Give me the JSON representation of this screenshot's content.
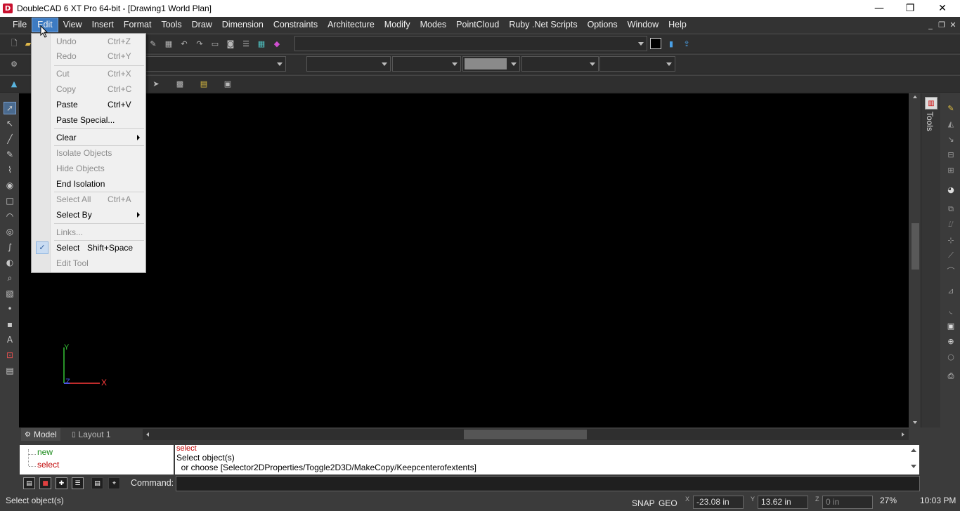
{
  "window": {
    "title": "DoubleCAD 6 XT Pro 64-bit - [Drawing1 World Plan]",
    "controls": {
      "minimize": "—",
      "restore": "❐",
      "close": "✕"
    }
  },
  "menubar": {
    "items": [
      "File",
      "Edit",
      "View",
      "Insert",
      "Format",
      "Tools",
      "Draw",
      "Dimension",
      "Constraints",
      "Architecture",
      "Modify",
      "Modes",
      "PointCloud",
      "Ruby .Net Scripts",
      "Options",
      "Window",
      "Help"
    ],
    "active": "Edit",
    "mdi_controls": {
      "minimize": "_",
      "restore": "❐",
      "close": "✕"
    }
  },
  "edit_menu": {
    "items": [
      {
        "label": "Undo",
        "shortcut": "Ctrl+Z",
        "enabled": false
      },
      {
        "label": "Redo",
        "shortcut": "Ctrl+Y",
        "enabled": false
      },
      {
        "label": "Cut",
        "shortcut": "Ctrl+X",
        "enabled": false
      },
      {
        "label": "Copy",
        "shortcut": "Ctrl+C",
        "enabled": false
      },
      {
        "label": "Paste",
        "shortcut": "Ctrl+V",
        "enabled": true
      },
      {
        "label": "Paste Special...",
        "shortcut": "",
        "enabled": true
      },
      {
        "label": "Clear",
        "shortcut": "",
        "enabled": true,
        "submenu": true
      },
      {
        "label": "Isolate Objects",
        "shortcut": "",
        "enabled": false
      },
      {
        "label": "Hide Objects",
        "shortcut": "",
        "enabled": false
      },
      {
        "label": "End Isolation",
        "shortcut": "",
        "enabled": true
      },
      {
        "label": "Select All",
        "shortcut": "Ctrl+A",
        "enabled": false
      },
      {
        "label": "Select By",
        "shortcut": "",
        "enabled": true,
        "submenu": true
      },
      {
        "label": "Links...",
        "shortcut": "",
        "enabled": false
      },
      {
        "label": "Select",
        "shortcut": "Shift+Space",
        "enabled": true,
        "checked": true
      },
      {
        "label": "Edit Tool",
        "shortcut": "",
        "enabled": false
      }
    ]
  },
  "panels": {
    "right_panel_label": "Tools"
  },
  "layout_tabs": [
    "Model",
    "Layout 1"
  ],
  "command_tree": [
    "new",
    "select"
  ],
  "command_history": [
    "select",
    "Select object(s)",
    "  or choose [Selector2DProperties/Toggle2D3D/MakeCopy/Keepcenterofextents]"
  ],
  "command_line": {
    "label": "Command:",
    "value": ""
  },
  "statusbar": {
    "message": "Select object(s)",
    "snap": "SNAP",
    "geo": "GEO",
    "x_label": "X",
    "x": "-23.08 in",
    "y_label": "Y",
    "y": "13.62 in",
    "z_label": "Z",
    "z": "0 in",
    "zoom": "27%",
    "time": "10:03 PM"
  },
  "axes": {
    "x_label": "X",
    "y_label": "Y",
    "z_label": "Z"
  },
  "colors": {
    "menu_active": "#3d7bc2",
    "x_axis": "#ff3b3b",
    "y_axis": "#35c235",
    "z_axis": "#4a55e6",
    "command_history_red": "#c00000",
    "command_tree_green": "#1a8a1a"
  }
}
